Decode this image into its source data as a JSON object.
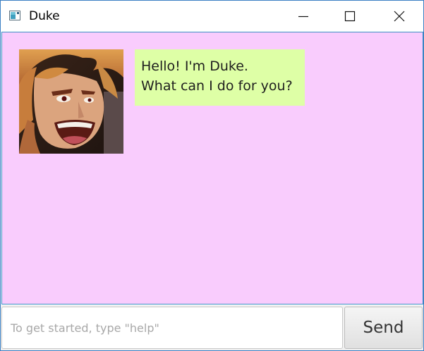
{
  "window": {
    "title": "Duke",
    "icon": "java-app-icon",
    "controls": [
      "minimize-icon",
      "maximize-icon",
      "close-icon"
    ]
  },
  "chat": {
    "background_color": "#f9ccfd",
    "messages": [
      {
        "sender": "duke",
        "avatar": "duke-avatar",
        "bubble_color": "#deffa6",
        "lines": [
          "Hello! I'm Duke.",
          "What can I do for you?"
        ]
      }
    ]
  },
  "input": {
    "placeholder": "To get started, type \"help\"",
    "value": ""
  },
  "send_button": {
    "label": "Send"
  }
}
